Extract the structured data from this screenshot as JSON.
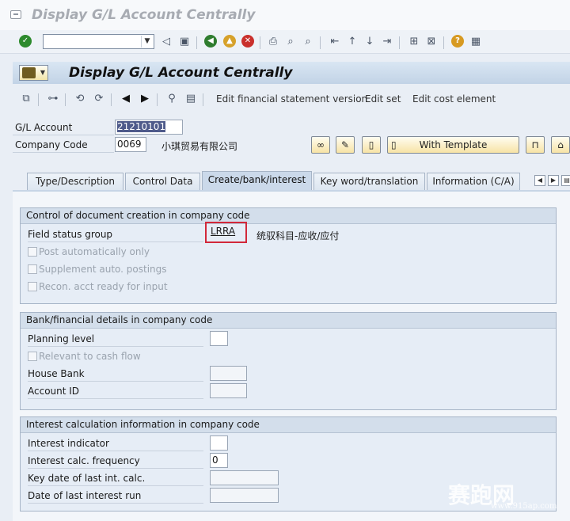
{
  "window": {
    "title": "Display G/L Account Centrally"
  },
  "toolbar": {
    "command_field_value": ""
  },
  "header": {
    "title": "Display G/L Account Centrally",
    "actions": [
      "Edit financial statement version",
      "Edit set",
      "Edit cost element"
    ],
    "with_template_label": "With Template"
  },
  "fields": {
    "gl_account": {
      "label": "G/L Account",
      "value": "21210101"
    },
    "company_code": {
      "label": "Company Code",
      "value": "0069",
      "description": "小琪贸易有限公司"
    }
  },
  "tabs": [
    {
      "label": "Type/Description"
    },
    {
      "label": "Control Data"
    },
    {
      "label": "Create/bank/interest"
    },
    {
      "label": "Key word/translation"
    },
    {
      "label": "Information (C/A)"
    }
  ],
  "groups": {
    "doc_creation": {
      "title": "Control of document creation in company code",
      "field_status_group": {
        "label": "Field status group",
        "value": "LRRA",
        "description": "统驭科目-应收/应付"
      },
      "checkboxes": [
        "Post automatically only",
        "Supplement auto. postings",
        "Recon. acct ready for input"
      ]
    },
    "bank": {
      "title": "Bank/financial details in company code",
      "planning_level": {
        "label": "Planning level",
        "value": ""
      },
      "relevant_cash_flow": "Relevant to cash flow",
      "house_bank": {
        "label": "House Bank",
        "value": ""
      },
      "account_id": {
        "label": "Account ID",
        "value": ""
      }
    },
    "interest": {
      "title": "Interest calculation information in company code",
      "interest_indicator": {
        "label": "Interest indicator",
        "value": ""
      },
      "interest_frequency": {
        "label": "Interest calc. frequency",
        "value": "0"
      },
      "key_date": {
        "label": "Key date of last int. calc.",
        "value": ""
      },
      "last_run": {
        "label": "Date of last interest run",
        "value": ""
      }
    }
  },
  "watermark": {
    "text": "赛跑网",
    "url": "www.915ap.com"
  }
}
